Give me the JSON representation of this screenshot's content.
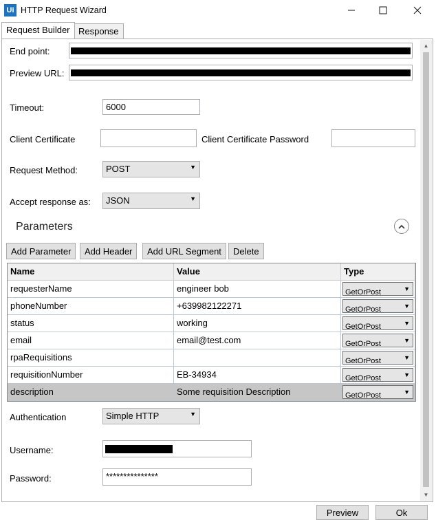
{
  "window": {
    "icon_text": "Ui",
    "title": "HTTP Request Wizard",
    "controls": {
      "minimize": "—",
      "maximize": "☐",
      "close": "✕"
    }
  },
  "tabs": [
    {
      "label": "Request Builder",
      "active": true
    },
    {
      "label": "Response",
      "active": false
    }
  ],
  "form": {
    "end_point_label": "End point:",
    "preview_url_label": "Preview URL:",
    "timeout_label": "Timeout:",
    "timeout_value": "6000",
    "client_certificate_label": "Client Certificate",
    "client_certificate_value": "",
    "client_certificate_password_label": "Client Certificate Password",
    "client_certificate_password_value": "",
    "request_method_label": "Request Method:",
    "request_method_value": "POST",
    "accept_response_label": "Accept response as:",
    "accept_response_value": "JSON"
  },
  "parameters": {
    "title": "Parameters",
    "collapse_icon": "chevron-up-icon",
    "buttons": {
      "add_parameter": "Add Parameter",
      "add_header": "Add Header",
      "add_url_segment": "Add URL Segment",
      "delete": "Delete"
    },
    "columns": {
      "name": "Name",
      "value": "Value",
      "type": "Type"
    },
    "rows": [
      {
        "name": "requesterName",
        "value": "engineer bob",
        "type": "GetOrPost"
      },
      {
        "name": "phoneNumber",
        "value": "+639982122271",
        "type": "GetOrPost"
      },
      {
        "name": "status",
        "value": "working",
        "type": "GetOrPost"
      },
      {
        "name": "email",
        "value": "email@test.com",
        "type": "GetOrPost"
      },
      {
        "name": "rpaRequisitions",
        "value": "",
        "type": "GetOrPost"
      },
      {
        "name": "requisitionNumber",
        "value": "EB-34934",
        "type": "GetOrPost"
      },
      {
        "name": "description",
        "value": "Some requisition Description",
        "type": "GetOrPost"
      }
    ]
  },
  "auth": {
    "authentication_label": "Authentication",
    "authentication_value": "Simple HTTP",
    "username_label": "Username:",
    "password_label": "Password:",
    "password_value": "***************"
  },
  "footer": {
    "preview": "Preview",
    "ok": "Ok"
  },
  "colors": {
    "selected_row": "#c6c6c6",
    "brand": "#1e73be"
  }
}
